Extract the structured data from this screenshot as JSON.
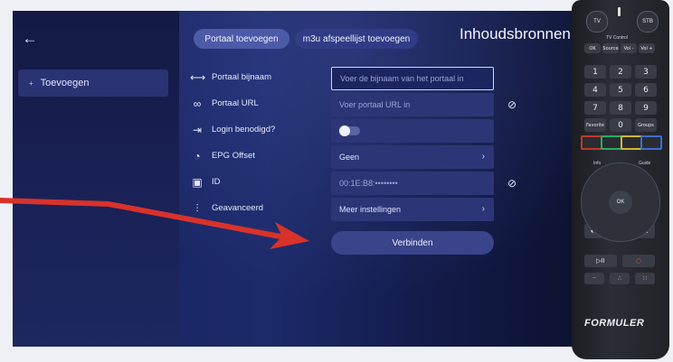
{
  "sidebar": {
    "back_icon": "arrow-left-icon",
    "items": [
      {
        "label": "Toevoegen",
        "icon": "plus-icon"
      }
    ]
  },
  "header": {
    "tabs": [
      {
        "label": "Portaal toevoegen",
        "active": true
      },
      {
        "label": "m3u afspeellijst toevoegen",
        "active": false
      }
    ],
    "title": "Inhoudsbronnen"
  },
  "form": {
    "rows": [
      {
        "icon": "swap-arrows-icon",
        "label": "Portaal bijnaam",
        "placeholder": "Voer de bijnaam van het portaal in"
      },
      {
        "icon": "link-icon",
        "label": "Portaal URL",
        "placeholder": "Voer portaal URL in",
        "eye_icon": "eye-slash-icon"
      },
      {
        "icon": "login-icon",
        "label": "Login benodigd?",
        "toggle": "off"
      },
      {
        "icon": "clock-icon",
        "label": "EPG Offset",
        "value": "Geen"
      },
      {
        "icon": "id-chip-icon",
        "label": "ID",
        "value": "00:1E:B8:••••••••",
        "eye_icon": "eye-slash-icon"
      },
      {
        "icon": "sliders-icon",
        "label": "Geavanceerd",
        "value": "Meer instellingen"
      }
    ],
    "connect_label": "Verbinden"
  },
  "colors": {
    "annotation_arrow": "#d9322b",
    "accent_tab": "#4d5aa8",
    "field_bg": "#2c3677"
  },
  "remote": {
    "top_left": "TV",
    "top_right": "STB",
    "caption": "TV Control",
    "mode_row": [
      "OK",
      "Source",
      "Vol -",
      "Vol +"
    ],
    "digits": [
      "1",
      "2",
      "3",
      "4",
      "5",
      "6",
      "7",
      "8",
      "9"
    ],
    "bottom_row": [
      "Favorite",
      "0",
      "Groups"
    ],
    "ok": "OK",
    "info": "Info",
    "guide": "Guide",
    "brand": "FORMULER"
  }
}
